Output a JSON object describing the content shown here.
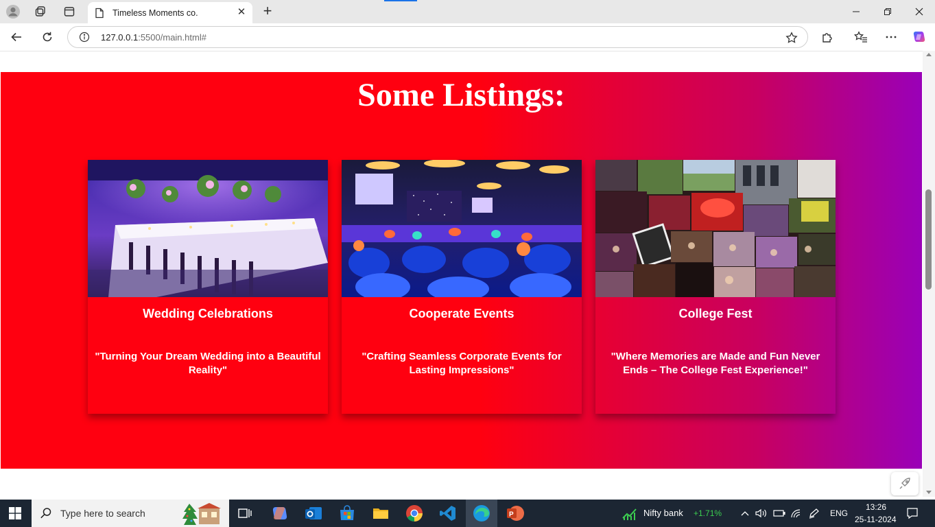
{
  "browser": {
    "tab_title": "Timeless Moments co.",
    "url_host": "127.0.0.1",
    "url_rest": ":5500/main.html#",
    "tab_close": "✕",
    "new_tab": "+"
  },
  "page": {
    "section_title": "Some Listings:",
    "listings": [
      {
        "title": "Wedding Celebrations",
        "description": "\"Turning Your Dream Wedding into a Beautiful Reality\"",
        "image": "wedding-banquet-photo"
      },
      {
        "title": "Cooperate Events",
        "description": "\"Crafting Seamless Corporate Events for Lasting Impressions\"",
        "image": "corporate-event-hall-photo"
      },
      {
        "title": "College Fest",
        "description": "\"Where Memories are Made and Fun Never Ends – The College Fest Experience!\"",
        "image": "college-fest-collage-photo"
      }
    ],
    "colors": {
      "gradient_start": "#ff0010",
      "gradient_end": "#9a00b8",
      "text": "#ffffff"
    }
  },
  "taskbar": {
    "search_placeholder": "Type here to search",
    "stock_name": "Nifty bank",
    "stock_change": "+1.71%",
    "language": "ENG",
    "time": "13:26",
    "date": "25-11-2024"
  }
}
